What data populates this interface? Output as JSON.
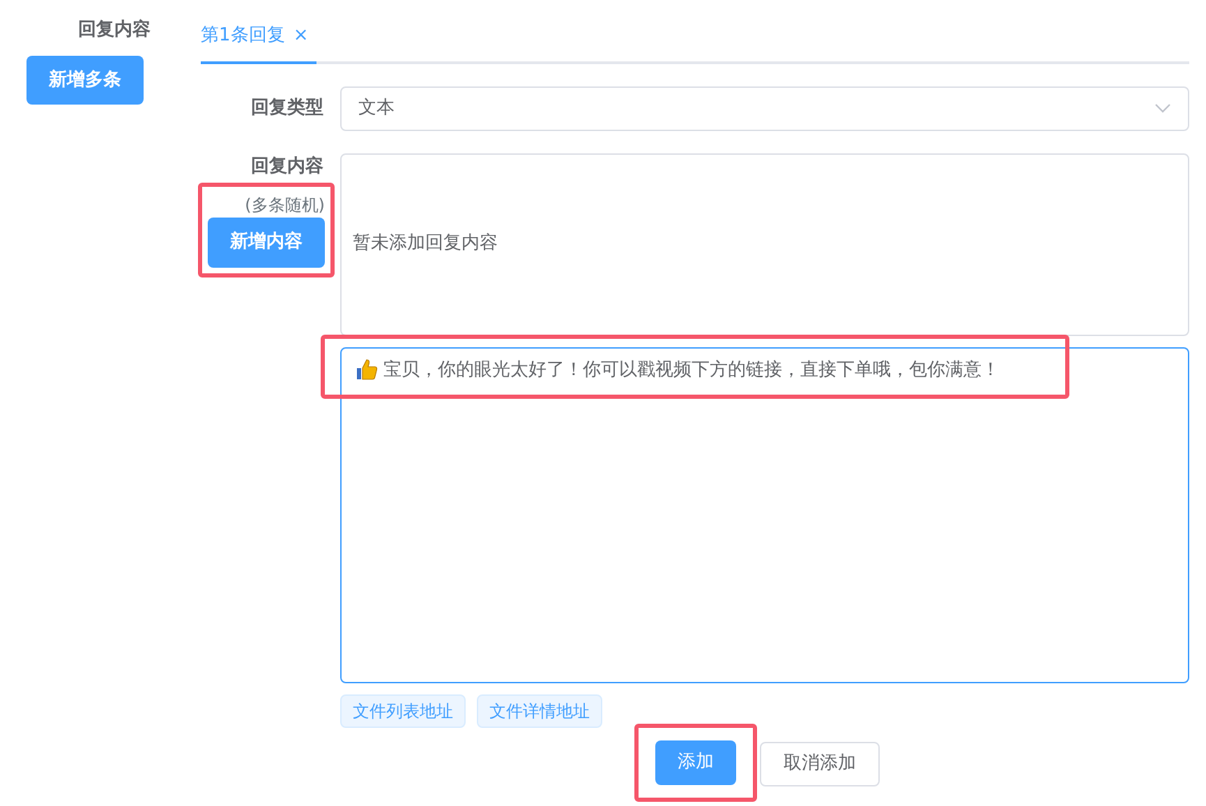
{
  "sidebar": {
    "label": "回复内容",
    "button": "新增多条"
  },
  "tabs": [
    {
      "label": "第1条回复",
      "close": "×",
      "selected": true
    }
  ],
  "form": {
    "type_label": "回复类型",
    "type_value": "文本",
    "content_label": "回复内容",
    "content_hint": "(多条随机)",
    "add_content_button": {
      "label": "新增内容",
      "highlighted": true
    },
    "content_empty": "暂未添加回复内容",
    "message": {
      "text": "宝贝，你的眼光太好了！你可以戳视频下方的链接，直接下单哦，包你满意！",
      "highlighted": true
    },
    "tags": [
      "文件列表地址",
      "文件详情地址"
    ],
    "actions": [
      {
        "label": "添加",
        "kind": "primary",
        "highlighted": true
      },
      {
        "label": "取消添加",
        "kind": "plain",
        "highlighted": false
      }
    ]
  }
}
